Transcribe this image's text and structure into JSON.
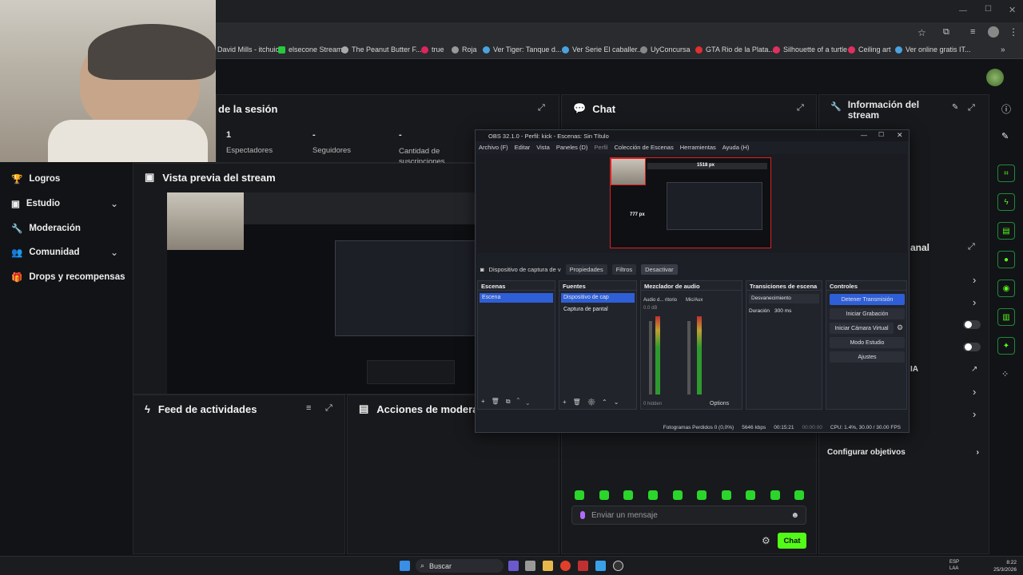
{
  "browser": {
    "bookmarks": [
      {
        "label": "David Mills - itchuio",
        "color": "#8a8a8a"
      },
      {
        "label": "elsecone Stream",
        "color": "#27c93f"
      },
      {
        "label": "The Peanut Butter F...",
        "color": "#aaaaaa"
      },
      {
        "label": "true",
        "color": "#e0245e"
      },
      {
        "label": "Roja",
        "color": "#999999"
      },
      {
        "label": "Ver Tiger: Tanque d...",
        "color": "#4aa3df"
      },
      {
        "label": "Ver Serie El caballer...",
        "color": "#4aa3df"
      },
      {
        "label": "UyConcursa",
        "color": "#888888"
      },
      {
        "label": "GTA Rio de la Plata...",
        "color": "#e03030"
      },
      {
        "label": "Silhouette of a turtle",
        "color": "#e03060"
      },
      {
        "label": "Ceiling art",
        "color": "#e03060"
      },
      {
        "label": "Ver online gratis IT...",
        "color": "#4aa3df"
      }
    ]
  },
  "sidebar": {
    "items": [
      {
        "label": "Logros",
        "icon": "trophy-icon"
      },
      {
        "label": "Estudio",
        "icon": "tv-icon",
        "expand": true
      },
      {
        "label": "Moderación",
        "icon": "wrench-icon"
      },
      {
        "label": "Comunidad",
        "icon": "people-icon",
        "expand": true
      },
      {
        "label": "Drops y recompensas",
        "icon": "gift-icon"
      }
    ]
  },
  "session": {
    "title": "de la sesión",
    "stats": [
      {
        "value": "1",
        "label": "Espectadores"
      },
      {
        "value": "-",
        "label": "Seguidores"
      },
      {
        "value": "-",
        "label": "Cantidad de suscripciones"
      }
    ]
  },
  "chat": {
    "title": "Chat",
    "placeholder": "Enviar un mensaje",
    "send_label": "Chat"
  },
  "info": {
    "title": "Información del stream",
    "canal_label": "anal",
    "ia_label": "IA",
    "objetivos": "Configurar objetivos"
  },
  "preview": {
    "title": "Vista previa del stream"
  },
  "feed": {
    "title": "Feed de actividades"
  },
  "acciones": {
    "title": "Acciones de moderado"
  },
  "obs": {
    "title": "OBS 32.1.0 - Perfil: kick - Escenas: Sin Título",
    "menu": [
      "Archivo (F)",
      "Editar",
      "Vista",
      "Paneles (D)",
      "Perfil",
      "Colección de Escenas",
      "Herramientas",
      "Ayuda (H)"
    ],
    "canvas_width_label": "1518 px",
    "canvas_height_label": "777 px",
    "source_bar": {
      "source": "Dispositivo de captura de v",
      "props": "Propiedades",
      "filters": "Filtros",
      "detach": "Desactivar"
    },
    "docks": {
      "scenes": {
        "title": "Escenas",
        "items": [
          "Escena"
        ]
      },
      "sources": {
        "title": "Fuentes",
        "items": [
          "Dispositivo de cap",
          "Captura de pantal"
        ]
      },
      "mixer": {
        "title": "Mezclador de audio",
        "ch1": "Audio d... ritorio",
        "ch2": "Mic/Aux",
        "global": "Global",
        "db": "0.0 dB",
        "hidden": "0 hidden",
        "options": "Options"
      },
      "transitions": {
        "title": "Transiciones de escena",
        "type": "Desvanecimiento",
        "duration_label": "Duración",
        "duration": "300 ms"
      },
      "controls": {
        "title": "Controles",
        "buttons": [
          "Detener Transmisión",
          "Iniciar Grabación",
          "Iniciar Cámara Virtual",
          "Modo Estudio",
          "Ajustes"
        ]
      }
    },
    "status": {
      "dropped": "Fotogramas Perdidos 0 (0,0%)",
      "bitrate": "5646 kbps",
      "live": "00:15:21",
      "rec": "00:00:00",
      "cpu": "CPU: 1.4%, 30.00 / 30.00 FPS"
    }
  },
  "taskbar": {
    "search": "Buscar",
    "lang": "ESP\nLAA",
    "time": "8:22",
    "date": "25/3/2026"
  },
  "colors": {
    "kick_green": "#53fc18",
    "obs_blue": "#2f5fd6",
    "accent_red": "#e02020"
  }
}
